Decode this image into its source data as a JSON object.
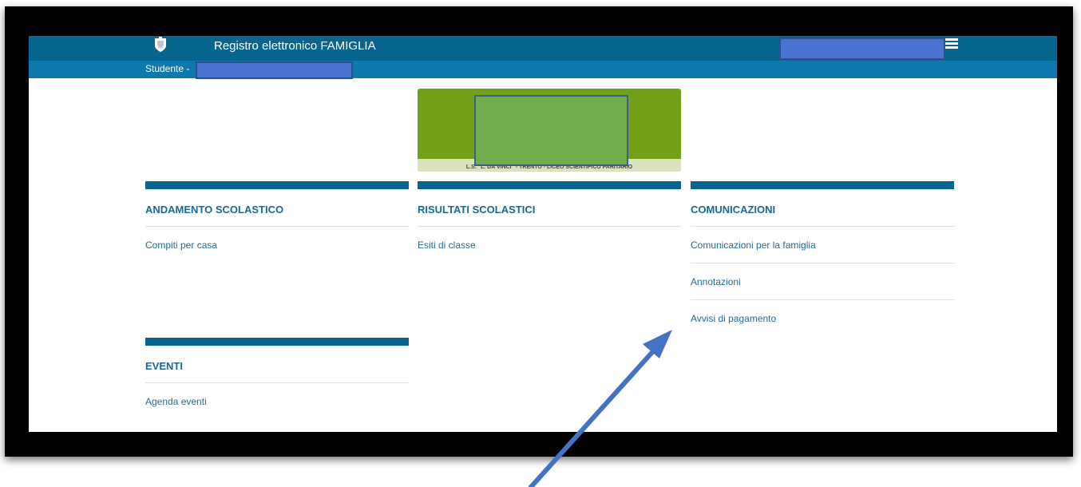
{
  "header": {
    "app_title": "Registro elettronico FAMIGLIA",
    "student_label": "Studente -",
    "menu_icon": "hamburger-menu-icon",
    "crest_icon": "coat-of-arms-icon"
  },
  "banner": {
    "school_text": "L.S. \"L. DA VINCI\" - TRENTO - LICEO SCIENTIFICO PARITARIO"
  },
  "sections": {
    "andamento": {
      "title": "ANDAMENTO SCOLASTICO",
      "items": [
        "Compiti per casa"
      ]
    },
    "risultati": {
      "title": "RISULTATI SCOLASTICI",
      "items": [
        "Esiti di classe"
      ]
    },
    "comunicazioni": {
      "title": "COMUNICAZIONI",
      "items": [
        "Comunicazioni per la famiglia",
        "Annotazioni",
        "Avvisi di pagamento"
      ]
    },
    "eventi": {
      "title": "EVENTI",
      "items": [
        "Agenda eventi"
      ]
    }
  },
  "colors": {
    "header_dark": "#06668f",
    "header_light": "#0d79ac",
    "section_title": "#1b6896",
    "link": "#2a6a93",
    "banner_green": "#72a119",
    "annotation_arrow": "#4472c4"
  }
}
